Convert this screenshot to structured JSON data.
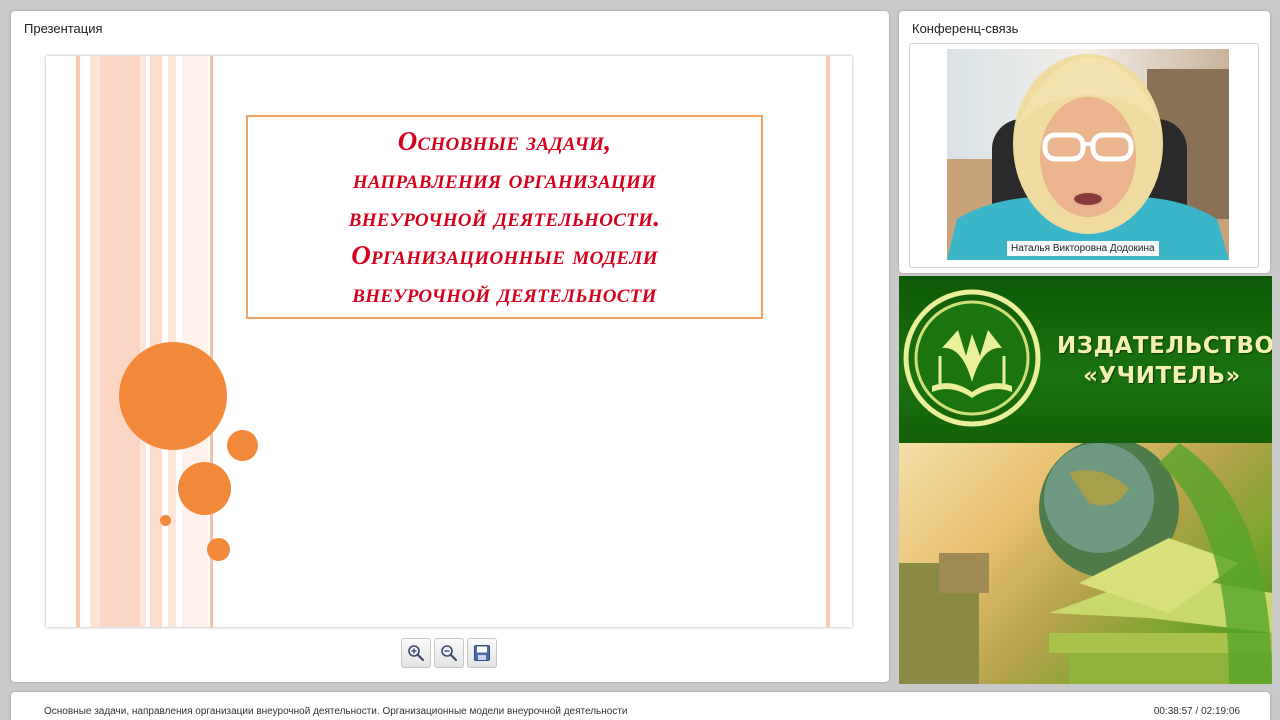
{
  "presentation": {
    "panel_title": "Презентация",
    "slide_title_lines": [
      "Основные задачи,",
      "направления организации",
      "внеурочной деятельности.",
      "Организационные модели",
      "внеурочной деятельности"
    ],
    "toolbar": [
      {
        "icon": "zoom-in-icon"
      },
      {
        "icon": "zoom-out-icon"
      },
      {
        "icon": "save-icon"
      }
    ]
  },
  "conference": {
    "panel_title": "Конференц-связь",
    "speaker_name": "Наталья Викторовна Додокина"
  },
  "banner": {
    "line1": "ИЗДАТЕЛЬСТВО",
    "line2": "«УЧИТЕЛЬ»"
  },
  "status": {
    "caption": "Основные задачи, направления организации внеурочной деятельности. Организационные модели внеурочной деятельности",
    "time": "00:38:57 / 02:19:06"
  },
  "colors": {
    "slide_title": "#d5001b",
    "accent_orange": "#f2893a",
    "banner_green": "#1a7210",
    "banner_text": "#f4f1b0"
  }
}
